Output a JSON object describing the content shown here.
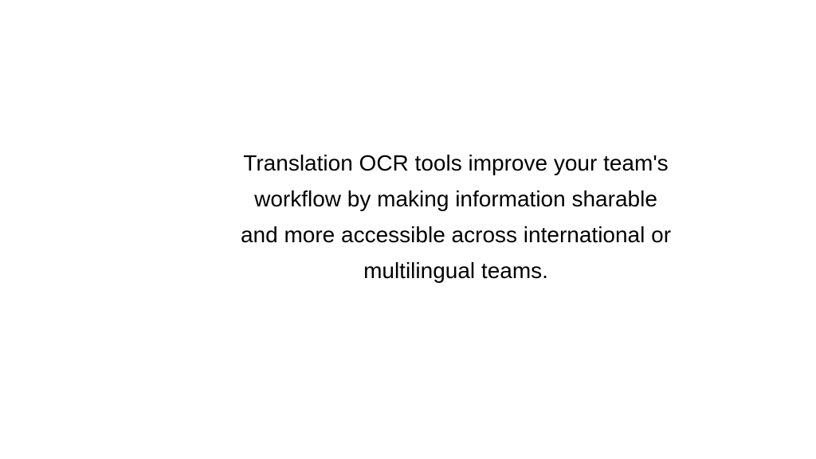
{
  "main": {
    "paragraph": "Translation OCR tools improve your team's workflow by making information sharable and more accessible across international or multilingual teams."
  }
}
